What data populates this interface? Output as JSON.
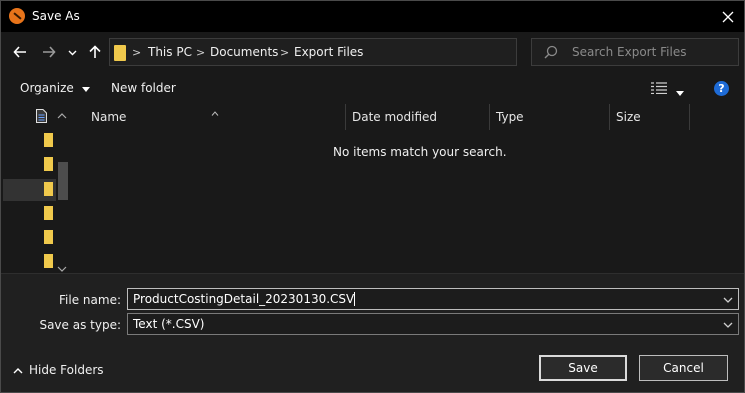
{
  "window": {
    "title": "Save As"
  },
  "nav": {
    "back_icon": "back-arrow-icon",
    "forward_icon": "forward-arrow-icon",
    "recent_icon": "chevron-down-icon",
    "up_icon": "up-arrow-icon",
    "breadcrumbs": [
      "This PC",
      "Documents",
      "Export Files"
    ],
    "search_placeholder": "Search Export Files"
  },
  "toolbar": {
    "organize_label": "Organize",
    "new_folder_label": "New folder",
    "help_label": "?"
  },
  "file_list": {
    "columns": [
      "Name",
      "Date modified",
      "Type",
      "Size"
    ],
    "empty_message": "No items match your search."
  },
  "form": {
    "file_name_label": "File name:",
    "file_name_value": "ProductCostingDetail_20230130.CSV",
    "save_type_label": "Save as type:",
    "save_type_value": "Text (*.CSV)"
  },
  "footer": {
    "hide_folders_label": "Hide Folders",
    "save_label": "Save",
    "cancel_label": "Cancel"
  },
  "colors": {
    "folder": "#f0c94c",
    "help": "#1e6bd6",
    "app_icon": "#e8741a"
  }
}
